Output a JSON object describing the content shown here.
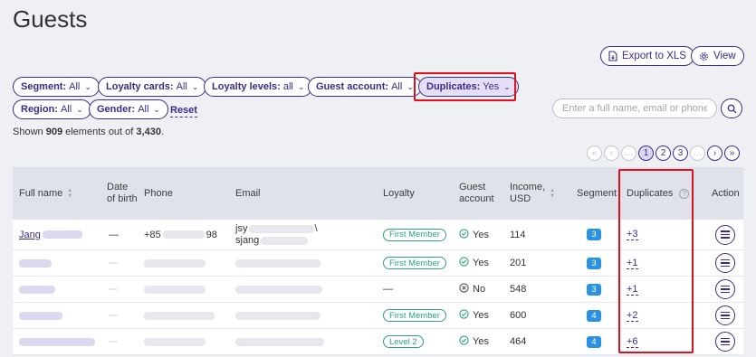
{
  "page": {
    "title": "Guests"
  },
  "toolbar": {
    "export_label": "Export to XLS",
    "view_label": "View"
  },
  "filters": [
    {
      "label": "Segment:",
      "value": "All"
    },
    {
      "label": "Loyalty cards:",
      "value": "All"
    },
    {
      "label": "Loyalty levels:",
      "value": "all"
    },
    {
      "label": "Guest account:",
      "value": "All"
    },
    {
      "label": "Duplicates:",
      "value": "Yes"
    },
    {
      "label": "Region:",
      "value": "All"
    },
    {
      "label": "Gender:",
      "value": "All"
    }
  ],
  "reset_label": "Reset",
  "search": {
    "placeholder": "Enter a full name, email or phone"
  },
  "summary": {
    "prefix": "Shown",
    "shown": "909",
    "middle": "elements out of",
    "total": "3,430",
    "suffix": "."
  },
  "pagination": {
    "pages": [
      "1",
      "2",
      "3"
    ],
    "current": "1",
    "ellipsis": "…"
  },
  "table": {
    "headers": {
      "full_name": "Full name",
      "dob": "Date of birth",
      "phone": "Phone",
      "email": "Email",
      "loyalty": "Loyalty",
      "guest_account": "Guest account",
      "income": "Income, USD",
      "segment": "Segment",
      "duplicates": "Duplicates",
      "action": "Action"
    },
    "rows": [
      {
        "name": "Jang",
        "dob": "—",
        "phone_start": "+85",
        "phone_end": "98",
        "email_line1": "jsy",
        "email_line2": "sjang",
        "email_mark": "\\",
        "loyalty": "First Member",
        "guest_account": "Yes",
        "income": "114",
        "segment": "3",
        "duplicates": "+3"
      },
      {
        "name": "",
        "dob": "",
        "phone_start": "",
        "phone_end": "",
        "email_line1": "",
        "email_line2": "",
        "email_mark": "",
        "loyalty": "First Member",
        "guest_account": "Yes",
        "income": "201",
        "segment": "3",
        "duplicates": "+1"
      },
      {
        "name": "",
        "dob": "",
        "phone_start": "",
        "phone_end": "",
        "email_line1": "",
        "email_line2": "",
        "email_mark": "",
        "loyalty": "—",
        "guest_account": "No",
        "income": "548",
        "segment": "3",
        "duplicates": "+1"
      },
      {
        "name": "",
        "dob": "",
        "phone_start": "",
        "phone_end": "",
        "email_line1": "",
        "email_line2": "",
        "email_mark": "",
        "loyalty": "First Member",
        "guest_account": "Yes",
        "income": "600",
        "segment": "4",
        "duplicates": "+2"
      },
      {
        "name": "",
        "dob": "",
        "phone_start": "",
        "phone_end": "",
        "email_line1": "",
        "email_line2": "",
        "email_mark": "",
        "loyalty": "Level 2",
        "guest_account": "Yes",
        "income": "464",
        "segment": "4",
        "duplicates": "+6"
      }
    ]
  },
  "colors": {
    "accent": "#3d2a8c",
    "highlight": "#e0101a",
    "segment_badge": "#2a92e0",
    "loyalty_tag": "#2f9e89"
  }
}
